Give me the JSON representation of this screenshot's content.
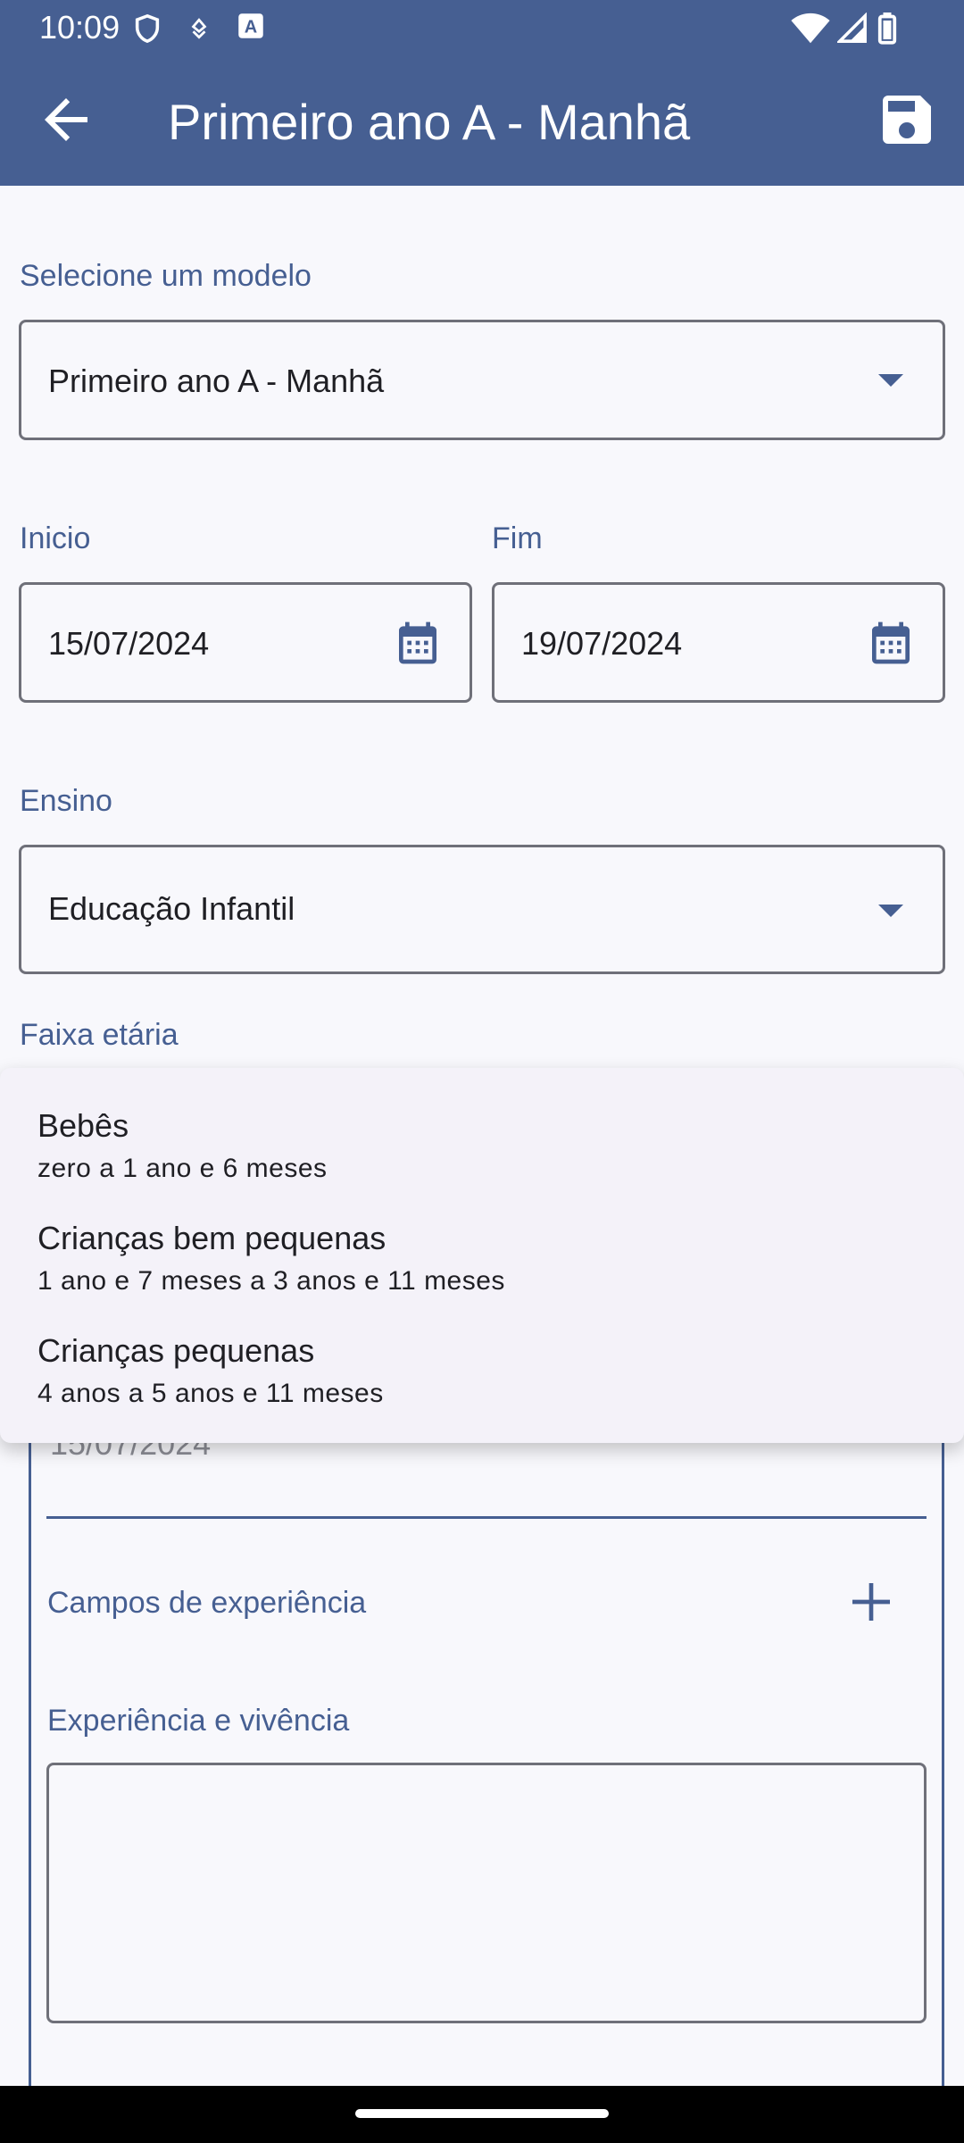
{
  "status_bar": {
    "time": "10:09",
    "icons": [
      "shield-icon",
      "notification-icon",
      "app-a-icon",
      "wifi-icon",
      "signal-icon",
      "battery-icon"
    ]
  },
  "app_bar": {
    "title": "Primeiro ano A - Manhã",
    "back_icon": "arrow-back-icon",
    "save_icon": "save-icon",
    "color": "#465f92"
  },
  "form": {
    "model": {
      "label": "Selecione um modelo",
      "value": "Primeiro ano A - Manhã"
    },
    "start": {
      "label": "Inicio",
      "value": "15/07/2024"
    },
    "end": {
      "label": "Fim",
      "value": "19/07/2024"
    },
    "teaching": {
      "label": "Ensino",
      "value": "Educação Infantil"
    },
    "age_range": {
      "label": "Faixa etária"
    },
    "card": {
      "date_value": "15/07/2024",
      "experience_fields_label": "Campos de experiência",
      "experience_label": "Experiência e vivência",
      "experience_value": ""
    }
  },
  "age_menu": {
    "items": [
      {
        "title": "Bebês",
        "subtitle": "zero a 1 ano e 6 meses"
      },
      {
        "title": "Crianças bem pequenas",
        "subtitle": "1 ano e 7 meses a 3 anos e 11 meses"
      },
      {
        "title": "Crianças pequenas",
        "subtitle": "4 anos a 5 anos e 11 meses"
      }
    ]
  }
}
